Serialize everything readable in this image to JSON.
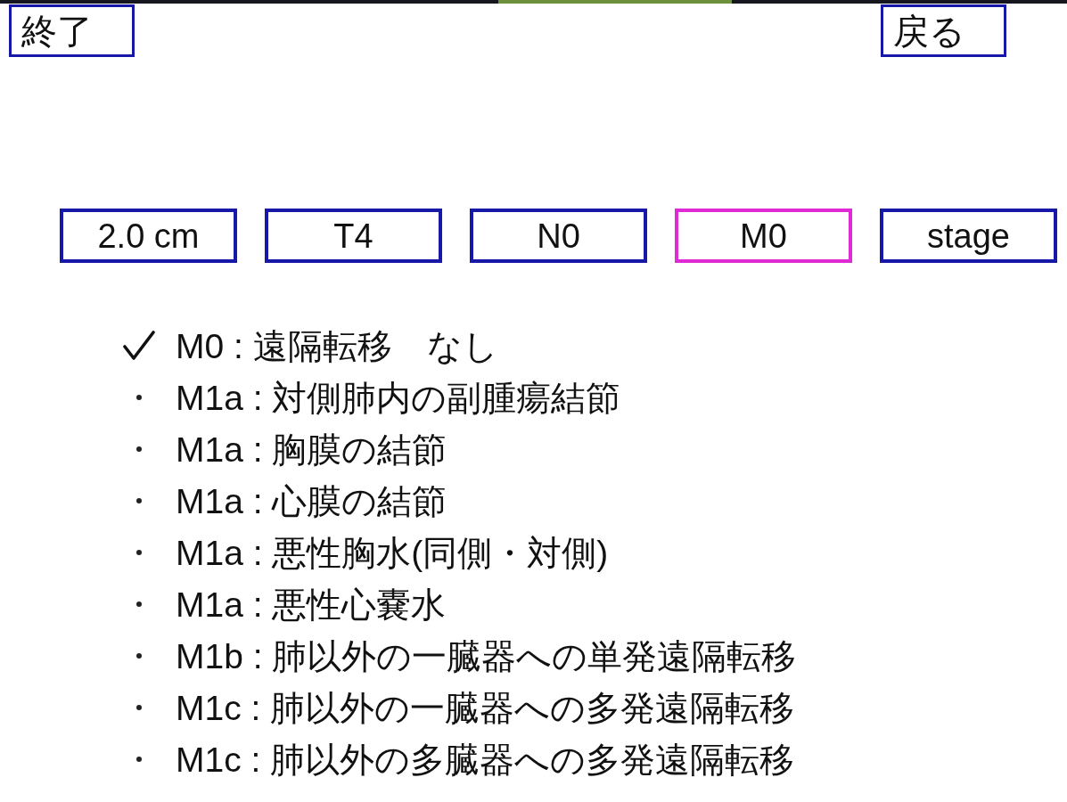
{
  "top_buttons": [
    {
      "label": "終了"
    },
    {
      "label": "戻る"
    }
  ],
  "tabs": [
    {
      "label": "2.0 cm",
      "selected": false
    },
    {
      "label": "T4",
      "selected": false
    },
    {
      "label": "N0",
      "selected": false
    },
    {
      "label": "M0",
      "selected": true
    },
    {
      "label": "stage",
      "selected": false
    }
  ],
  "options": [
    {
      "label": "M0 : 遠隔転移　なし",
      "selected": true
    },
    {
      "label": "M1a : 対側肺内の副腫瘍結節",
      "selected": false
    },
    {
      "label": "M1a : 胸膜の結節",
      "selected": false
    },
    {
      "label": "M1a : 心膜の結節",
      "selected": false
    },
    {
      "label": "M1a : 悪性胸水(同側・対側)",
      "selected": false
    },
    {
      "label": "M1a : 悪性心嚢水",
      "selected": false
    },
    {
      "label": "M1b : 肺以外の一臓器への単発遠隔転移",
      "selected": false
    },
    {
      "label": "M1c : 肺以外の一臓器への多発遠隔転移",
      "selected": false
    },
    {
      "label": "M1c : 肺以外の多臓器への多発遠隔転移",
      "selected": false
    }
  ]
}
